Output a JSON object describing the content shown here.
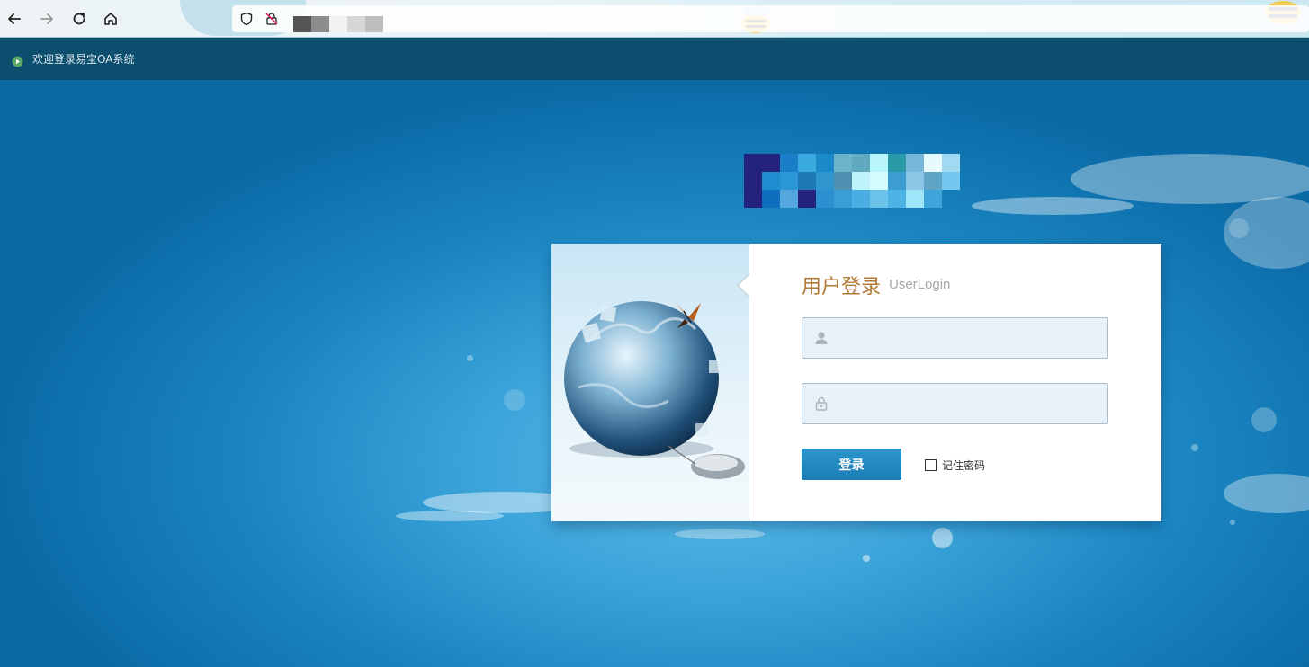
{
  "browser": {
    "back_icon": "arrow-left-icon",
    "forward_icon": "arrow-right-icon",
    "reload_icon": "reload-icon",
    "home_icon": "home-icon",
    "shield_icon": "shield-icon",
    "site_icon": "blocked-lock-icon"
  },
  "header": {
    "title": "欢迎登录易宝OA系统",
    "icon": "play-circle-icon"
  },
  "login": {
    "title": "用户登录",
    "subtitle": "UserLogin",
    "username_value": "",
    "password_value": "",
    "username_icon": "user-icon",
    "password_icon": "lock-icon",
    "button_label": "登录",
    "remember_label": "记住密码",
    "remember_checked": false
  },
  "colors": {
    "header_bg": "#0c4e6e",
    "title": "#b07a35",
    "button": "#1c7db5",
    "field_bg": "#e8f1f8"
  }
}
